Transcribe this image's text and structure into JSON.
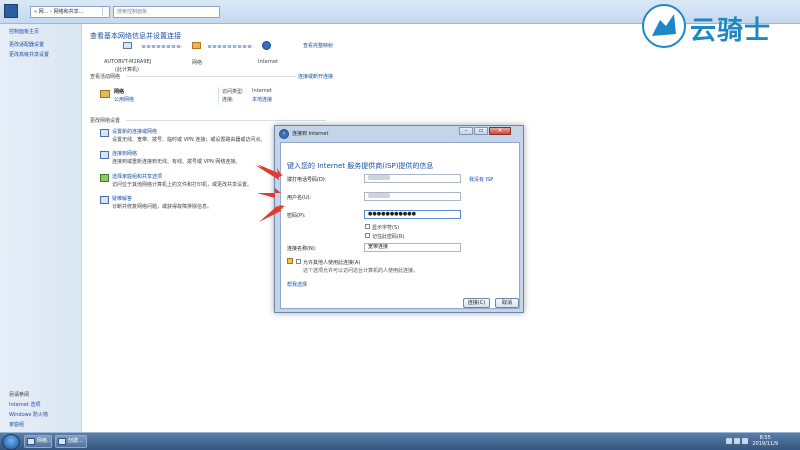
{
  "window": {
    "address": "« 网... › 网络和共享...",
    "search_placeholder": "搜索控制面板"
  },
  "leftnav": {
    "items": [
      "控制面板主页",
      "更改适配器设置",
      "更改高级共享设置"
    ],
    "see_also_title": "另请参阅",
    "see_also": [
      "Internet 选项",
      "Windows 防火墙",
      "家庭组"
    ]
  },
  "main": {
    "title": "查看基本网络信息并设置连接",
    "view_full_map": "查看完整映射",
    "map": {
      "computer": "AUTOBVT-M2RA9EJ",
      "computer_sub": "(此计算机)",
      "network": "网络",
      "internet": "Internet"
    },
    "active_networks_title": "查看活动网络",
    "connect_or_disconnect": "连接或断开连接",
    "network_name": "网络",
    "network_type": "公用网络",
    "access_type_label": "访问类型:",
    "access_type_value": "Internet",
    "connection_label": "连接:",
    "connection_value": "本地连接",
    "change_settings_title": "更改网络设置",
    "tasks": [
      {
        "title": "设置新的连接或网络",
        "desc": "设置无线、宽带、拨号、临时或 VPN 连接；或设置路由器或访问点。"
      },
      {
        "title": "连接到网络",
        "desc": "连接到或重新连接到无线、有线、拨号或 VPN 网络连接。"
      },
      {
        "title": "选择家庭组和共享选项",
        "desc": "访问位于其他网络计算机上的文件和打印机，或更改共享设置。"
      },
      {
        "title": "疑难解答",
        "desc": "诊断并修复网络问题，或获得故障排除信息。"
      }
    ]
  },
  "dialog": {
    "title": "连接到 Internet",
    "heading": "键入您的 Internet 服务提供商(ISP)提供的信息",
    "username_label": "用户名(U):",
    "password_label": "密码(P):",
    "password_value": "●●●●●●●●●●●",
    "show_chars": "显示字符(S)",
    "remember_password": "记住此密码(R)",
    "connection_name_label": "连接名称(N):",
    "connection_name_value": "宽带连接",
    "isp_link": "我没有 ISP",
    "allow_others": "允许其他人使用此连接(A)",
    "allow_others_desc": "这个选项允许可以访问这台计算机的人使用此连接。",
    "connect_button": "连接(C)",
    "cancel_button": "取消"
  },
  "taskbar": {
    "tasks": [
      "网络...",
      "创建..."
    ],
    "time": "8:55",
    "date": "2019/11/9"
  },
  "watermark": {
    "text": "云骑士"
  },
  "colors": {
    "link": "#1b50a3",
    "arrow": "#e23b2e",
    "watermark": "#1e88c7"
  }
}
